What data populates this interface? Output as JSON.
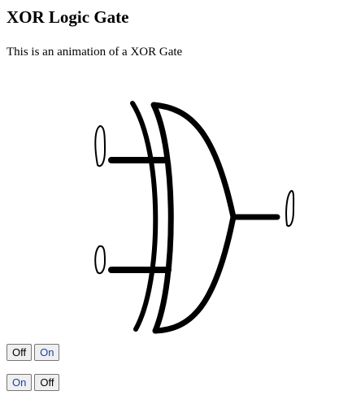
{
  "page": {
    "title": "XOR Logic Gate",
    "intro": "This is an animation of a XOR Gate"
  },
  "controls": {
    "row_a": {
      "off_label": "Off",
      "on_label": "On"
    },
    "row_b": {
      "on_label": "On",
      "off_label": "Off"
    }
  },
  "colors": {
    "gate_stroke": "#000000",
    "on_label_text": "#1a3fb0"
  }
}
